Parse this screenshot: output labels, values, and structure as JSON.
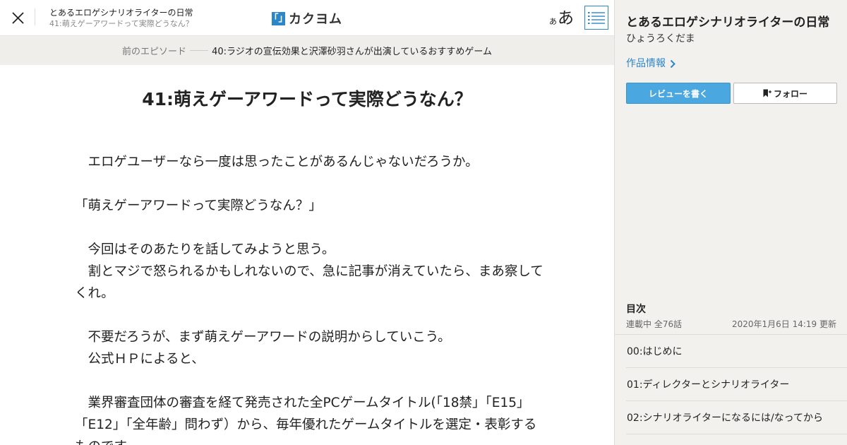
{
  "header": {
    "work_title": "とあるエロゲシナリオライターの日常",
    "episode_title": "41:萌えゲーアワードって実際どうなん？",
    "logo_mark": "「」",
    "logo_text": "カクヨム",
    "font_size_small": "あ",
    "font_size_large": "あ",
    "close_icon": "close-icon",
    "menu_icon": "list-icon"
  },
  "prev_episode": {
    "label": "前のエピソード",
    "title": "40:ラジオの宣伝効果と沢澤砂羽さんが出演しているおすすめゲーム"
  },
  "episode": {
    "title": "41:萌えゲーアワードって実際どうなん？",
    "paragraphs": [
      "　エロゲユーザーなら一度は思ったことがあるんじゃないだろうか。",
      "",
      "「萌えゲーアワードって実際どうなん？」",
      "",
      "　今回はそのあたりを話してみようと思う。",
      "　割とマジで怒られるかもしれないので、急に記事が消えていたら、まあ察してくれ。",
      "",
      "　不要だろうが、まず萌えゲーアワードの説明からしていこう。",
      "　公式ＨＰによると、",
      "",
      "　業界審査団体の審査を経て発売された全PCゲームタイトル(「18禁」「E15」「E12」「全年齢」問わず）から、毎年優れたゲームタイトルを選定・表彰するものです。"
    ]
  },
  "sidebar": {
    "work_title": "とあるエロゲシナリオライターの日常",
    "author": "ひょうろくだま",
    "work_info_link": "作品情報",
    "review_button": "レビューを書く",
    "follow_button": "フォロー",
    "toc": {
      "heading": "目次",
      "status": "連載中 全76話",
      "updated": "2020年1月6日 14:19 更新",
      "items": [
        "00:はじめに",
        "01:ディレクターとシナリオライター",
        "02:シナリオライターになるには/なってから"
      ]
    },
    "accent_color": "#2b87c9"
  }
}
